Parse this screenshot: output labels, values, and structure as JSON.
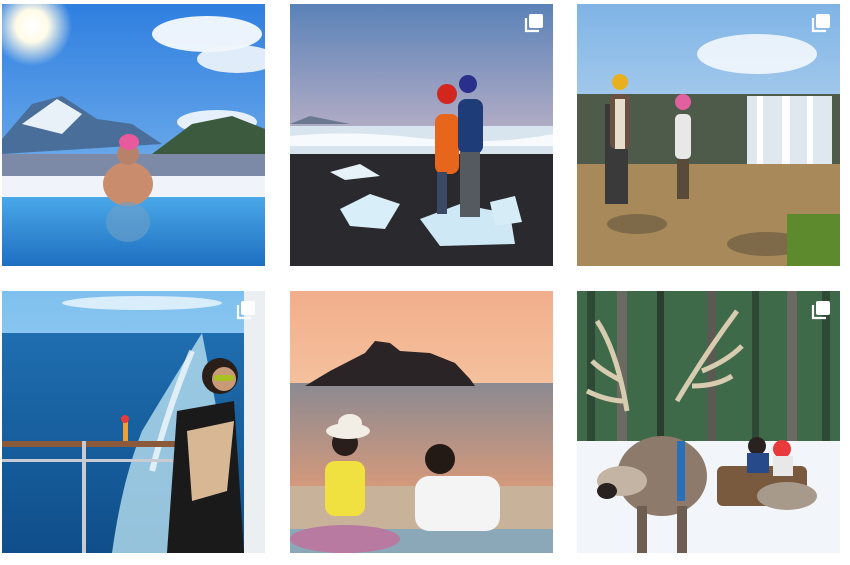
{
  "grid": {
    "posts": [
      {
        "scene": "hot-spring-snowy-mountains",
        "multiple_images": false
      },
      {
        "scene": "couple-on-ice-beach",
        "multiple_images": true
      },
      {
        "scene": "couple-at-waterfall",
        "multiple_images": true
      },
      {
        "scene": "cruise-ship-deck-ocean",
        "multiple_images": true
      },
      {
        "scene": "couple-sunset-beach-rock",
        "multiple_images": false
      },
      {
        "scene": "reindeer-sled-forest",
        "multiple_images": true
      }
    ]
  },
  "icons": {
    "multiple_images": "stacked-squares-icon"
  },
  "colors": {
    "background": "#ffffff",
    "icon": "#ffffff"
  }
}
